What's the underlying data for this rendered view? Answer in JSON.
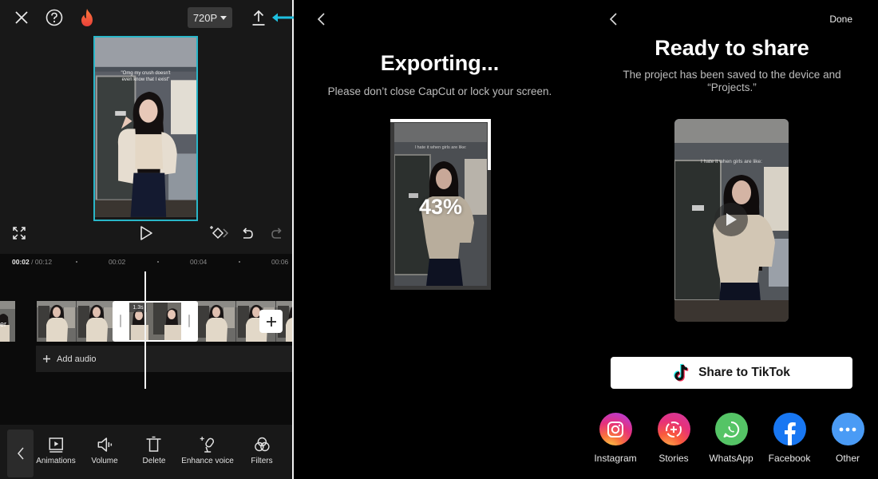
{
  "editor": {
    "resolution_label": "720P",
    "caption_top": "\"Omg my crush doesn't",
    "caption_bottom": "even know that I exist\"",
    "ruler": {
      "current": "00:02",
      "separator": " / ",
      "total": "00:12",
      "ticks": [
        "00:02",
        "00:04",
        "00:06"
      ]
    },
    "selected_clip_duration": "1.3s",
    "left_clip_label": "er",
    "add_audio_label": "Add audio",
    "tools": [
      {
        "label": "Animations",
        "icon": "animations-icon"
      },
      {
        "label": "Volume",
        "icon": "volume-icon"
      },
      {
        "label": "Delete",
        "icon": "delete-icon"
      },
      {
        "label": "Enhance voice",
        "icon": "enhance-voice-icon"
      },
      {
        "label": "Filters",
        "icon": "filters-icon"
      }
    ],
    "accent_color": "#29b6c8"
  },
  "exporting": {
    "title": "Exporting...",
    "subtitle": "Please don’t close CapCut or lock your screen.",
    "progress_percent": 43,
    "progress_label": "43%",
    "caption": "I hate it when girls are like:"
  },
  "ready": {
    "done_label": "Done",
    "title": "Ready to share",
    "subtitle": "The project has been saved to the device and “Projects.”",
    "caption": "I hate it when girls are like:",
    "tiktok_button": "Share to TikTok",
    "share_targets": [
      {
        "label": "Instagram",
        "icon": "instagram-icon"
      },
      {
        "label": "Stories",
        "icon": "stories-icon"
      },
      {
        "label": "WhatsApp",
        "icon": "whatsapp-icon"
      },
      {
        "label": "Facebook",
        "icon": "facebook-icon"
      },
      {
        "label": "Other",
        "icon": "more-icon"
      }
    ]
  }
}
